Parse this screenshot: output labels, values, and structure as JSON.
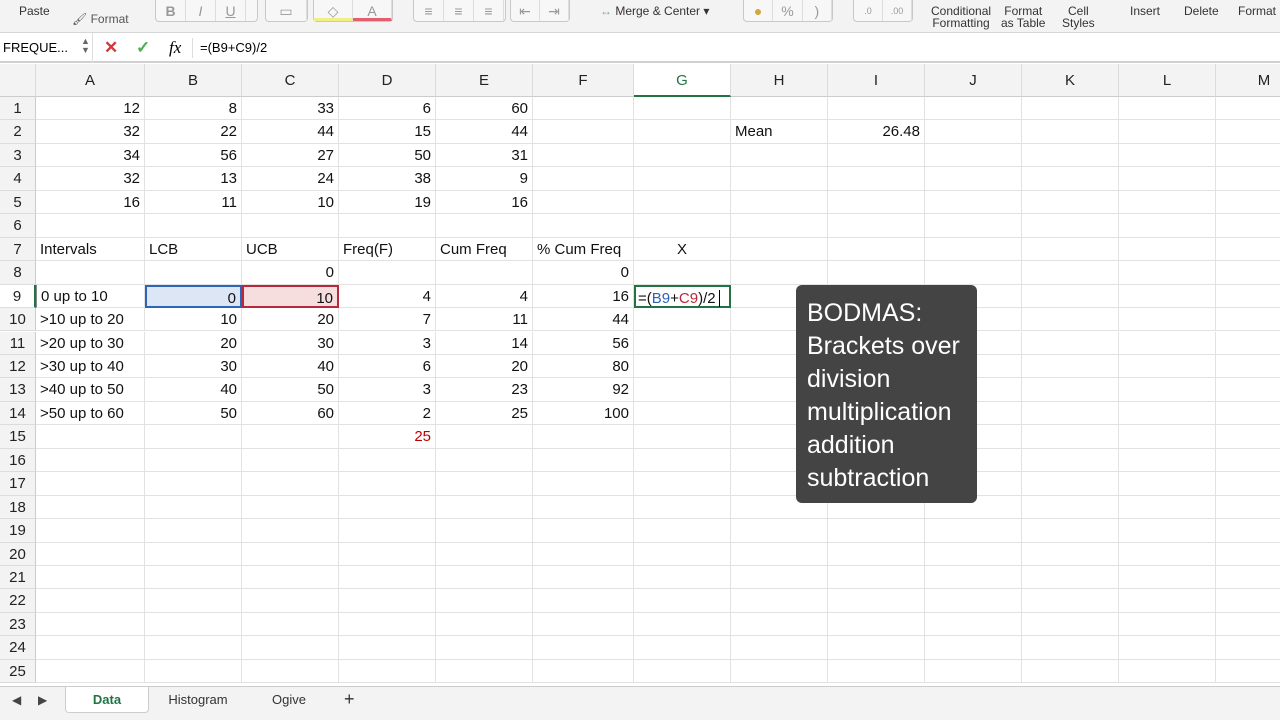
{
  "ribbon": {
    "paste": "Paste",
    "format": "Format",
    "bold": "B",
    "italic": "I",
    "underline": "U",
    "merge": "Merge & Center",
    "percent": "%",
    "comma": ")",
    "cond1": "Conditional",
    "cond2": "Formatting",
    "fat1": "Format",
    "fat2": "as Table",
    "cs1": "Cell",
    "cs2": "Styles",
    "insert": "Insert",
    "delete": "Delete",
    "format_cells": "Format"
  },
  "formula_bar": {
    "name_box": "FREQUE...",
    "cancel": "✕",
    "enter": "✓",
    "fx": "fx",
    "formula": "=(B9+C9)/2"
  },
  "columns": [
    "A",
    "B",
    "C",
    "D",
    "E",
    "F",
    "G",
    "H",
    "I",
    "J",
    "K",
    "L",
    "M"
  ],
  "selected_column": "G",
  "selected_row": 9,
  "rows": [
    [
      "12",
      "8",
      "33",
      "6",
      "60",
      "",
      "",
      "",
      ""
    ],
    [
      "32",
      "22",
      "44",
      "15",
      "44",
      "",
      "",
      "Mean",
      "26.48"
    ],
    [
      "34",
      "56",
      "27",
      "50",
      "31"
    ],
    [
      "32",
      "13",
      "24",
      "38",
      "9"
    ],
    [
      "16",
      "11",
      "10",
      "19",
      "16"
    ],
    [],
    [
      "Intervals",
      "LCB",
      "UCB",
      "Freq(F)",
      "Cum Freq",
      "% Cum Freq",
      "X"
    ],
    [
      "",
      "",
      "0",
      "",
      "",
      "0"
    ],
    [
      "0 up to 10",
      "0",
      "10",
      "4",
      "4",
      "16"
    ],
    [
      ">10 up to 20",
      "10",
      "20",
      "7",
      "11",
      "44"
    ],
    [
      ">20 up to 30",
      "20",
      "30",
      "3",
      "14",
      "56"
    ],
    [
      ">30 up to 40",
      "30",
      "40",
      "6",
      "20",
      "80"
    ],
    [
      ">40 up to 50",
      "40",
      "50",
      "3",
      "23",
      "92"
    ],
    [
      ">50 up to 60",
      "50",
      "60",
      "2",
      "25",
      "100"
    ],
    [
      "",
      "",
      "",
      "25"
    ],
    [],
    [],
    [],
    [],
    [],
    [],
    [],
    [],
    [],
    []
  ],
  "edit_cell": {
    "prefix": "=(",
    "ref1": "B9",
    "plus": "+",
    "ref2": "C9",
    "suffix": ")/2"
  },
  "colors": {
    "ref1": "#2e63b8",
    "ref2": "#b8283a",
    "total": "#c00000",
    "accent": "#217346"
  },
  "tooltip": {
    "lines": [
      "BODMAS:",
      "Brackets over",
      "division",
      "multiplication",
      "addition",
      "subtraction"
    ]
  },
  "sheet_tabs": [
    {
      "label": "Data",
      "active": true
    },
    {
      "label": "Histogram"
    },
    {
      "label": "Ogive"
    }
  ],
  "add_sheet": "+"
}
